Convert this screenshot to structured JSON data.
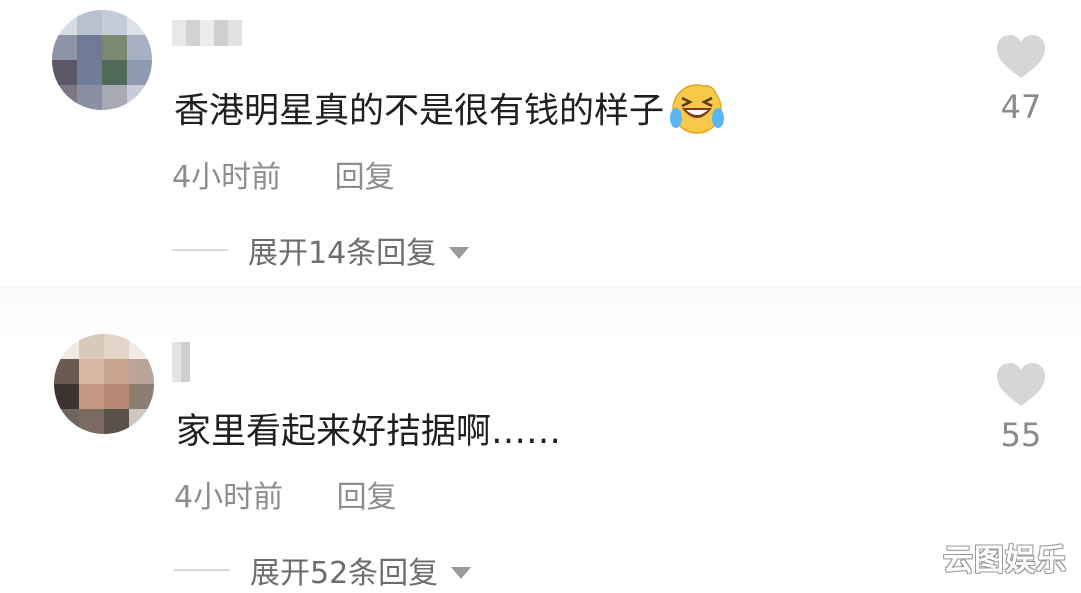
{
  "comments": [
    {
      "text": "香港明星真的不是很有钱的样子",
      "emoji": "laughing-tears-emoji",
      "time": "4小时前",
      "reply_label": "回复",
      "expand_label": "展开14条回复",
      "likes": "47",
      "username_blurred": true
    },
    {
      "text": "家里看起来好拮据啊……",
      "time": "4小时前",
      "reply_label": "回复",
      "expand_label": "展开52条回复",
      "likes": "55",
      "username_blurred": true
    }
  ],
  "watermark": "云图娱乐",
  "colors": {
    "text": "#1f1f1f",
    "meta": "#8d8d8d",
    "heart": "#d6d6d6",
    "like_count": "#8a8a8a"
  },
  "icons": [
    "heart-icon",
    "chevron-down-icon",
    "laughing-tears-emoji"
  ]
}
